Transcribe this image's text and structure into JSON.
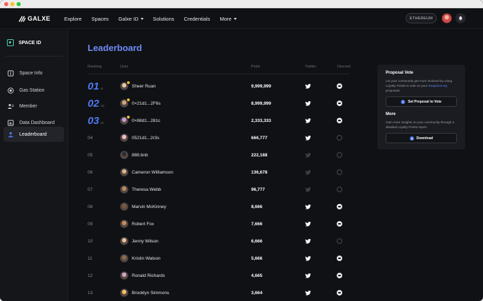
{
  "nav": {
    "brand": "GALXE",
    "links": [
      {
        "label": "Explore",
        "has_caret": false
      },
      {
        "label": "Spaces",
        "has_caret": false
      },
      {
        "label": "Galxe ID",
        "has_caret": true
      },
      {
        "label": "Solutions",
        "has_caret": false
      },
      {
        "label": "Credentials",
        "has_caret": false
      },
      {
        "label": "More",
        "has_caret": true
      }
    ],
    "chain": "ETHEREUM"
  },
  "sidebar": {
    "space_name": "SPACE ID",
    "items": [
      {
        "label": "Space Info",
        "icon": "info-icon"
      },
      {
        "label": "Gas Station",
        "icon": "gas-station-icon"
      },
      {
        "label": "Member",
        "icon": "member-icon"
      },
      {
        "label": "Data Dashboard",
        "icon": "dashboard-icon"
      },
      {
        "label": "Leaderboard",
        "icon": "leaderboard-icon",
        "active": true
      }
    ]
  },
  "leaderboard": {
    "title": "Leaderboard",
    "columns": {
      "ranking": "Ranking",
      "user": "User",
      "point": "Point",
      "twitter": "Twitter",
      "discord": "Discord"
    },
    "rows": [
      {
        "rank": "01",
        "suffix": "st",
        "user": "Sheer Ruan",
        "points": "9,999,999",
        "twitter": true,
        "discord": true,
        "badge": true
      },
      {
        "rank": "02",
        "suffix": "nd",
        "user": "0×21d1...2F6s",
        "points": "8,999,999",
        "twitter": true,
        "discord": true,
        "badge": true
      },
      {
        "rank": "03",
        "suffix": "rd",
        "user": "0×88d1...281c",
        "points": "2,333,333",
        "twitter": true,
        "discord": true,
        "badge": true
      },
      {
        "rank": "04",
        "suffix": "",
        "user": "0521d1...2r3s",
        "points": "666,777",
        "twitter": true,
        "discord": false,
        "badge": false
      },
      {
        "rank": "05",
        "suffix": "",
        "user": "888.bnb",
        "points": "222,188",
        "twitter": false,
        "discord": false,
        "badge": false
      },
      {
        "rank": "06",
        "suffix": "",
        "user": "Cameron Williamson",
        "points": "136,678",
        "twitter": false,
        "discord": false,
        "badge": false
      },
      {
        "rank": "07",
        "suffix": "",
        "user": "Theresa Webb",
        "points": "96,777",
        "twitter": false,
        "discord": false,
        "badge": false
      },
      {
        "rank": "08",
        "suffix": "",
        "user": "Marvin McKinney",
        "points": "8,666",
        "twitter": true,
        "discord": true,
        "badge": false
      },
      {
        "rank": "09",
        "suffix": "",
        "user": "Robert Fox",
        "points": "7,666",
        "twitter": true,
        "discord": true,
        "badge": false
      },
      {
        "rank": "10",
        "suffix": "",
        "user": "Jenny Wilson",
        "points": "6,666",
        "twitter": true,
        "discord": false,
        "badge": false
      },
      {
        "rank": "11",
        "suffix": "",
        "user": "Kristin Watson",
        "points": "5,666",
        "twitter": true,
        "discord": true,
        "badge": false
      },
      {
        "rank": "12",
        "suffix": "",
        "user": "Ronald Richards",
        "points": "4,665",
        "twitter": true,
        "discord": true,
        "badge": false
      },
      {
        "rank": "13",
        "suffix": "",
        "user": "Brooklyn Simmons",
        "points": "3,664",
        "twitter": true,
        "discord": true,
        "badge": false
      }
    ]
  },
  "panel": {
    "vote_title": "Proposal Vote",
    "vote_text_before": "Let your community get more involved by using Loyalty Points to vote on your ",
    "vote_link": "Snapshot.org",
    "vote_text_after": " proposals.",
    "vote_button": "Set Proposal to Vote",
    "more_title": "More",
    "more_text": "Gain more insights on your community through a detailed Loyalty Points report.",
    "download_button": "Download"
  },
  "colors": {
    "accent": "#4e79f2",
    "title": "#6f8bf7",
    "background": "#101114",
    "sidebar": "#15161a"
  }
}
